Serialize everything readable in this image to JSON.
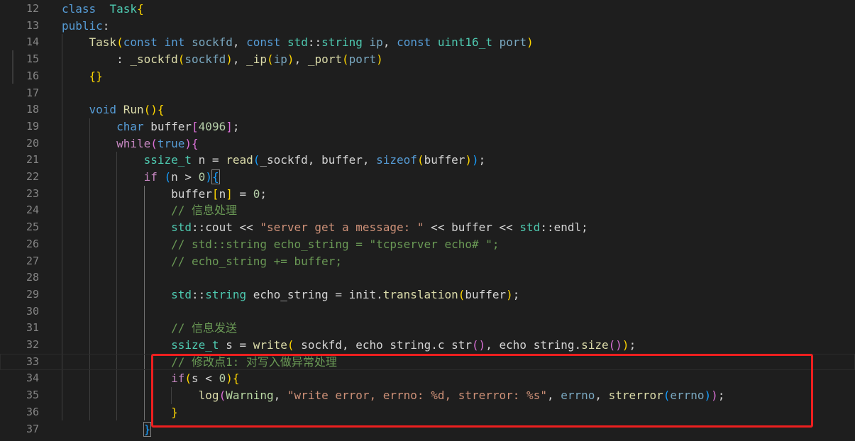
{
  "editor": {
    "accent_colors": {
      "background": "#1e1e1e",
      "line_number": "#858585",
      "keyword": "#569cd6",
      "type": "#4ec9b0",
      "function": "#dcdcaa",
      "string": "#ce9178",
      "comment": "#6a9955",
      "number": "#b5cea8",
      "annotation_box": "#ee1f1f"
    },
    "lines": [
      {
        "n": "12",
        "tokens": [
          [
            "kw",
            "class"
          ],
          [
            "",
            "  "
          ],
          [
            "ty",
            "Task"
          ],
          [
            "br1",
            "{"
          ]
        ]
      },
      {
        "n": "13",
        "tokens": [
          [
            "kw",
            "public"
          ],
          [
            "",
            ":"
          ]
        ]
      },
      {
        "n": "14",
        "tokens": [
          [
            "",
            "    "
          ],
          [
            "fn",
            "Task"
          ],
          [
            "br1",
            "("
          ],
          [
            "kw",
            "const"
          ],
          [
            "",
            " "
          ],
          [
            "kw",
            "int"
          ],
          [
            "",
            " "
          ],
          [
            "par",
            "sockfd"
          ],
          [
            "",
            ", "
          ],
          [
            "kw",
            "const"
          ],
          [
            "",
            " "
          ],
          [
            "ty",
            "std"
          ],
          [
            "",
            "::"
          ],
          [
            "ty",
            "string"
          ],
          [
            "",
            " "
          ],
          [
            "par",
            "ip"
          ],
          [
            "",
            ", "
          ],
          [
            "kw",
            "const"
          ],
          [
            "",
            " "
          ],
          [
            "ty",
            "uint16_t"
          ],
          [
            "",
            " "
          ],
          [
            "par",
            "port"
          ],
          [
            "br1",
            ")"
          ]
        ]
      },
      {
        "n": "15",
        "tokens": [
          [
            "",
            "        : "
          ],
          [
            "fn",
            "_sockfd"
          ],
          [
            "br1",
            "("
          ],
          [
            "par",
            "sockfd"
          ],
          [
            "br1",
            ")"
          ],
          [
            "",
            ", "
          ],
          [
            "fn",
            "_ip"
          ],
          [
            "br1",
            "("
          ],
          [
            "par",
            "ip"
          ],
          [
            "br1",
            ")"
          ],
          [
            "",
            ", "
          ],
          [
            "fn",
            "_port"
          ],
          [
            "br1",
            "("
          ],
          [
            "par",
            "port"
          ],
          [
            "br1",
            ")"
          ]
        ]
      },
      {
        "n": "16",
        "tokens": [
          [
            "",
            "    "
          ],
          [
            "br1",
            "{}"
          ]
        ]
      },
      {
        "n": "17",
        "tokens": [
          [
            "",
            ""
          ]
        ]
      },
      {
        "n": "18",
        "tokens": [
          [
            "",
            "    "
          ],
          [
            "kw",
            "void"
          ],
          [
            "",
            " "
          ],
          [
            "fn",
            "Run"
          ],
          [
            "br1",
            "()"
          ],
          [
            "br1",
            "{"
          ]
        ]
      },
      {
        "n": "19",
        "tokens": [
          [
            "",
            "        "
          ],
          [
            "kw",
            "char"
          ],
          [
            "",
            " buffer"
          ],
          [
            "br2",
            "["
          ],
          [
            "num",
            "4096"
          ],
          [
            "br2",
            "]"
          ],
          [
            "",
            ";"
          ]
        ]
      },
      {
        "n": "20",
        "tokens": [
          [
            "",
            "        "
          ],
          [
            "ctl",
            "while"
          ],
          [
            "br2",
            "("
          ],
          [
            "kw",
            "true"
          ],
          [
            "br2",
            ")"
          ],
          [
            "br2",
            "{"
          ]
        ]
      },
      {
        "n": "21",
        "tokens": [
          [
            "",
            "            "
          ],
          [
            "ty",
            "ssize_t"
          ],
          [
            "",
            " n = "
          ],
          [
            "fn",
            "read"
          ],
          [
            "br3",
            "("
          ],
          [
            "",
            "_sockfd, buffer, "
          ],
          [
            "kw",
            "sizeof"
          ],
          [
            "br1",
            "("
          ],
          [
            "",
            "buffer"
          ],
          [
            "br1",
            ")"
          ],
          [
            "br3",
            ")"
          ],
          [
            "",
            ";"
          ]
        ]
      },
      {
        "n": "22",
        "tokens": [
          [
            "",
            "            "
          ],
          [
            "ctl",
            "if"
          ],
          [
            "",
            " "
          ],
          [
            "br3",
            "("
          ],
          [
            "",
            "n > "
          ],
          [
            "num",
            "0"
          ],
          [
            "br3",
            ")"
          ],
          [
            "br3m",
            "{"
          ]
        ]
      },
      {
        "n": "23",
        "tokens": [
          [
            "",
            "                buffer"
          ],
          [
            "br1",
            "["
          ],
          [
            "",
            "n"
          ],
          [
            "br1",
            "]"
          ],
          [
            "",
            " = "
          ],
          [
            "num",
            "0"
          ],
          [
            "",
            ";"
          ]
        ]
      },
      {
        "n": "24",
        "tokens": [
          [
            "",
            "                "
          ],
          [
            "cm",
            "// 信息处理"
          ]
        ]
      },
      {
        "n": "25",
        "tokens": [
          [
            "",
            "                "
          ],
          [
            "ty",
            "std"
          ],
          [
            "",
            "::cout << "
          ],
          [
            "str",
            "\"server get a message: \""
          ],
          [
            "",
            " << buffer << "
          ],
          [
            "ty",
            "std"
          ],
          [
            "",
            "::endl;"
          ]
        ]
      },
      {
        "n": "26",
        "tokens": [
          [
            "",
            "                "
          ],
          [
            "cm",
            "// std::string echo_string = \"tcpserver echo# \";"
          ]
        ]
      },
      {
        "n": "27",
        "tokens": [
          [
            "",
            "                "
          ],
          [
            "cm",
            "// echo_string += buffer;"
          ]
        ]
      },
      {
        "n": "28",
        "tokens": [
          [
            "",
            ""
          ]
        ]
      },
      {
        "n": "29",
        "tokens": [
          [
            "",
            "                "
          ],
          [
            "ty",
            "std"
          ],
          [
            "",
            "::"
          ],
          [
            "ty",
            "string"
          ],
          [
            "",
            " echo_string = init."
          ],
          [
            "fn",
            "translation"
          ],
          [
            "br1",
            "("
          ],
          [
            "",
            "buffer"
          ],
          [
            "br1",
            ")"
          ],
          [
            "",
            ";"
          ]
        ]
      },
      {
        "n": "30",
        "tokens": [
          [
            "",
            ""
          ]
        ]
      },
      {
        "n": "31",
        "tokens": [
          [
            "",
            "                "
          ],
          [
            "cm",
            "// 信息发送"
          ]
        ]
      },
      {
        "n": "32",
        "tokens": [
          [
            "",
            "                "
          ],
          [
            "ty",
            "ssize_t"
          ],
          [
            "",
            " s = "
          ],
          [
            "fn",
            "write"
          ],
          [
            "br1",
            "("
          ],
          [
            "",
            " sockfd, echo string.c str"
          ],
          [
            "br2",
            "()"
          ],
          [
            "",
            ", echo string."
          ],
          [
            "fn",
            "size"
          ],
          [
            "br2",
            "()"
          ],
          [
            "br1",
            ")"
          ],
          [
            "",
            ";"
          ]
        ]
      },
      {
        "n": "33",
        "tokens": [
          [
            "",
            "                "
          ],
          [
            "cm",
            "// 修改点1: 对写入做异常处理"
          ]
        ]
      },
      {
        "n": "34",
        "tokens": [
          [
            "",
            "                "
          ],
          [
            "ctl",
            "if"
          ],
          [
            "br1",
            "("
          ],
          [
            "",
            "s < "
          ],
          [
            "num",
            "0"
          ],
          [
            "br1",
            ")"
          ],
          [
            "br1",
            "{"
          ]
        ]
      },
      {
        "n": "35",
        "tokens": [
          [
            "",
            "                    "
          ],
          [
            "fn",
            "log"
          ],
          [
            "br2",
            "("
          ],
          [
            "enm",
            "Warning"
          ],
          [
            "",
            ", "
          ],
          [
            "str",
            "\"write error, errno: %d, strerror: %s\""
          ],
          [
            "",
            ", "
          ],
          [
            "par",
            "errno"
          ],
          [
            "",
            ", "
          ],
          [
            "fn",
            "strerror"
          ],
          [
            "br3",
            "("
          ],
          [
            "par",
            "errno"
          ],
          [
            "br3",
            ")"
          ],
          [
            "br2",
            ")"
          ],
          [
            "",
            ";"
          ]
        ]
      },
      {
        "n": "36",
        "tokens": [
          [
            "",
            "                "
          ],
          [
            "br1",
            "}"
          ]
        ]
      },
      {
        "n": "37",
        "tokens": [
          [
            "",
            "            "
          ],
          [
            "br3m",
            "}"
          ]
        ]
      }
    ]
  }
}
